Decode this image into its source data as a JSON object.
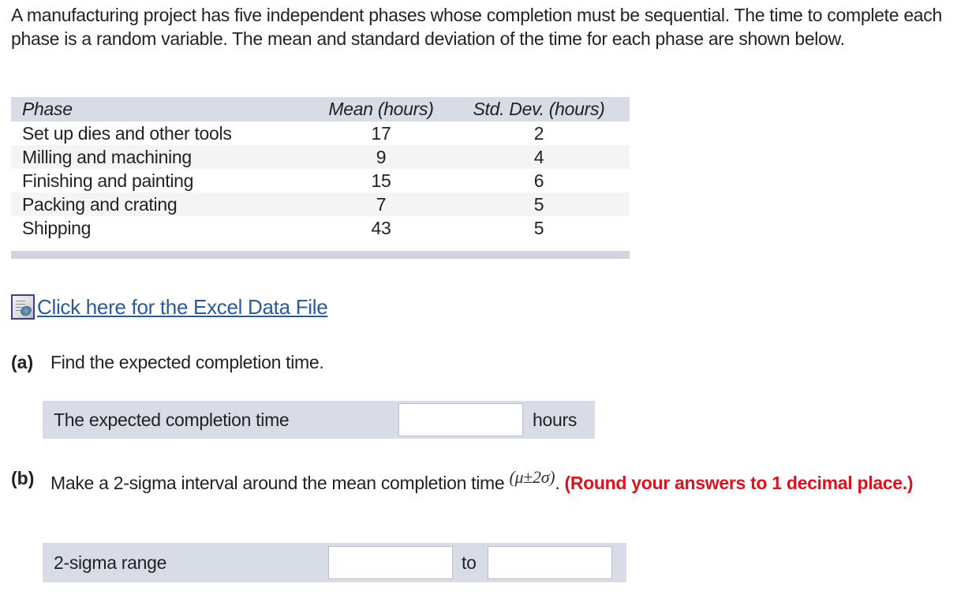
{
  "intro": "A manufacturing project has five independent phases whose completion must be sequential. The time to complete each phase is a random variable. The mean and standard deviation of the time for each phase are shown below.",
  "table": {
    "headers": [
      "Phase",
      "Mean (hours)",
      "Std. Dev. (hours)"
    ],
    "rows": [
      {
        "phase": "Set up dies and other tools",
        "mean": "17",
        "sd": "2"
      },
      {
        "phase": "Milling and machining",
        "mean": "9",
        "sd": "4"
      },
      {
        "phase": "Finishing and painting",
        "mean": "15",
        "sd": "6"
      },
      {
        "phase": "Packing and crating",
        "mean": "7",
        "sd": "5"
      },
      {
        "phase": "Shipping",
        "mean": "43",
        "sd": "5"
      }
    ]
  },
  "excel_link": {
    "icon": "excel-file-icon",
    "label": "Click here for the Excel Data File"
  },
  "part_a": {
    "label": "(a)",
    "question": "Find the expected completion time.",
    "answer_label": "The expected completion time",
    "input_value": "",
    "unit": "hours"
  },
  "part_b": {
    "label": "(b)",
    "question": "Make a 2-sigma interval around the mean completion time",
    "formula": "(μ±2σ)",
    "period": ".",
    "note": "(Round your answers to 1 decimal place.)",
    "answer_label": "2-sigma range",
    "lower_value": "",
    "connector": "to",
    "upper_value": ""
  },
  "colors": {
    "panel": "#d8dce6",
    "link": "#2a5a9e",
    "note": "#e0101c"
  }
}
